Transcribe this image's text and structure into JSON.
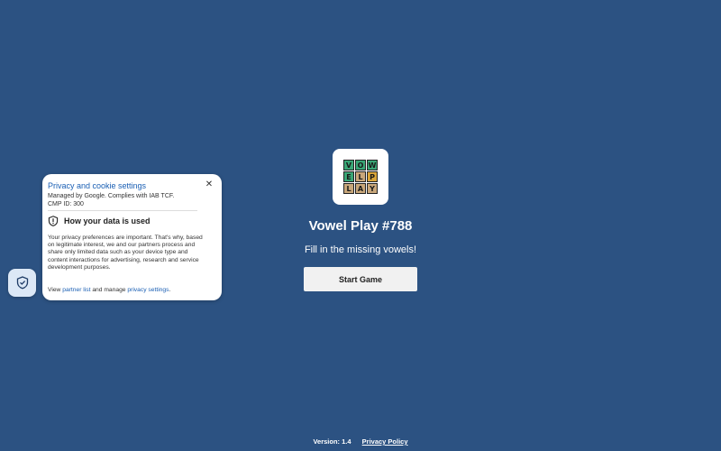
{
  "game": {
    "logo_rows": [
      [
        "V",
        "O",
        "W"
      ],
      [
        "E",
        "L",
        "P"
      ],
      [
        "L",
        "A",
        "Y"
      ]
    ],
    "logo_colors": {
      "green": "#3aa676",
      "yellow": "#d9a53a",
      "brown": "#c9a77a"
    },
    "title": "Vowel Play #788",
    "tagline": "Fill in the missing vowels!",
    "start_label": "Start Game"
  },
  "footer": {
    "version": "Version: 1.4",
    "privacy_label": "Privacy Policy"
  },
  "consent": {
    "title": "Privacy and cookie settings",
    "managed_line1": "Managed by Google. Complies with IAB TCF.",
    "managed_line2": "CMP ID: 300",
    "section_title": "How your data is used",
    "body": "Your privacy preferences are important. That's why, based on legitimate interest, we and our partners process and share only limited data such as your device type and content interactions for advertising, research and service development purposes.",
    "links_prefix": "View ",
    "partner_link": "partner list",
    "links_middle": " and manage ",
    "settings_link": "privacy settings",
    "links_suffix": ".",
    "close_icon": "close-icon",
    "section_icon": "shield-alert-icon"
  },
  "fab": {
    "icon": "shield-check-icon"
  },
  "colors": {
    "background": "#2c5282",
    "button": "#f1f1f1",
    "link": "#1a5fb4"
  }
}
